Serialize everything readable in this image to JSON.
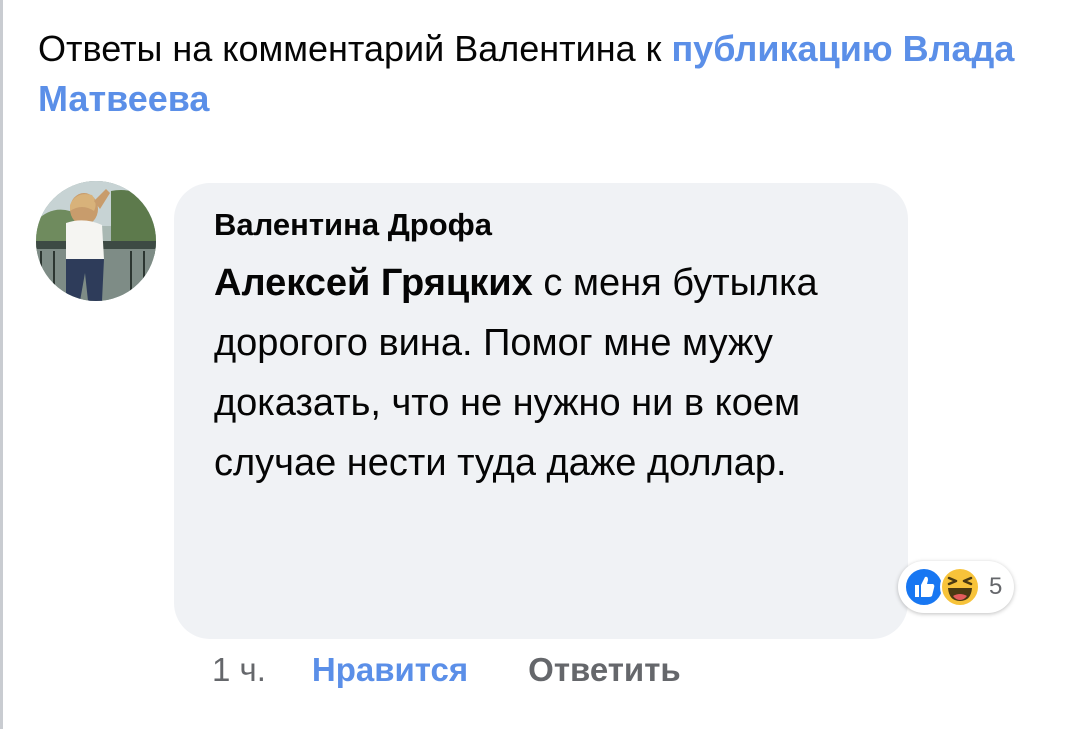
{
  "header": {
    "prefix": "Ответы на комментарий Валентина к ",
    "post_link": "публикацию Влада Матвеева"
  },
  "comment": {
    "author": "Валентина Дрофа",
    "mention": "Алексей Гряцких",
    "text": " с меня бутылка дорогого вина. Помог мне мужу доказать, что не нужно ни в коем случае нести туда даже доллар.",
    "reactions": {
      "icons": [
        "like-icon",
        "haha-icon"
      ],
      "count": "5"
    }
  },
  "actions": {
    "time": "1 ч.",
    "like_label": "Нравится",
    "reply_label": "Ответить"
  },
  "colors": {
    "link": "#5b8fe8",
    "bubble": "#f0f2f5",
    "meta": "#65676b"
  }
}
